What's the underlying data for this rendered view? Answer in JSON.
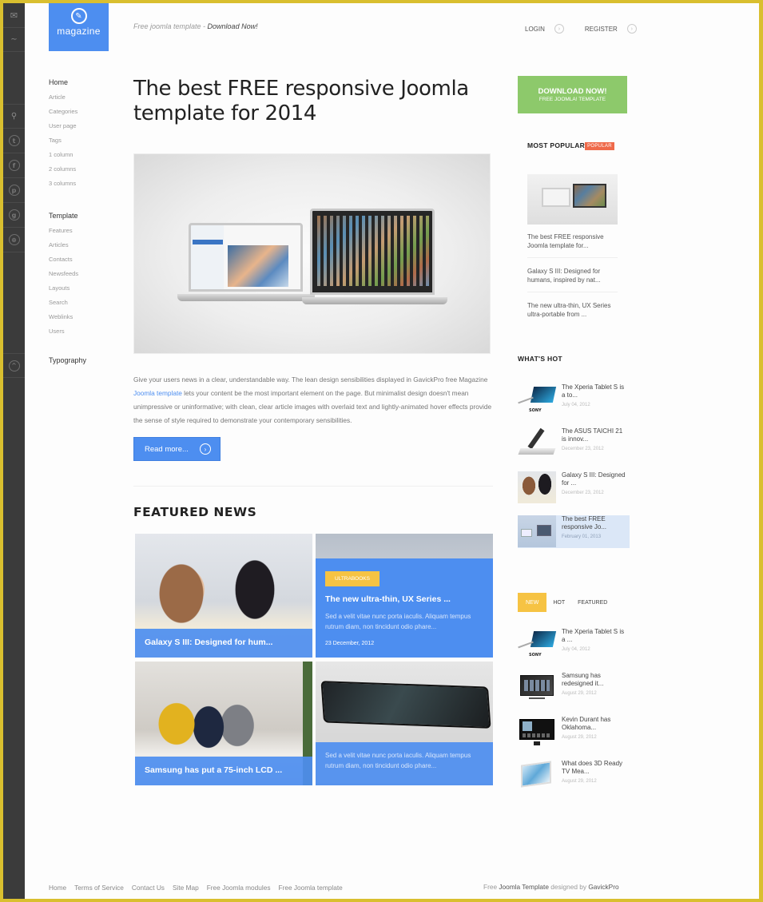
{
  "header": {
    "logo_text": "magazine",
    "tagline_prefix": "Free joomla template - ",
    "tagline_link": "Download Now!",
    "login": "LOGIN",
    "register": "REGISTER"
  },
  "side_bar_icons": [
    "mail-icon",
    "rss-icon",
    "search-icon",
    "twitter-icon",
    "facebook-icon",
    "pinterest-icon",
    "google-plus-icon",
    "globe-icon",
    "scroll-top-icon"
  ],
  "left_nav": {
    "groups": [
      {
        "title": "Home",
        "items": [
          "Article",
          "Categories",
          "User page",
          "Tags",
          "1 column",
          "2 columns",
          "3 columns"
        ]
      },
      {
        "title": "Template",
        "items": [
          "Features",
          "Articles",
          "Contacts",
          "Newsfeeds",
          "Layouts",
          "Search",
          "Weblinks",
          "Users"
        ]
      },
      {
        "title": "Typography",
        "items": []
      }
    ]
  },
  "main": {
    "title": "The best FREE responsive Joomla template for 2014",
    "text_before_link": "Give your users news in a clear, understandable way. The lean design sensibilities displayed in GavickPro free Magazine ",
    "text_link": "Joomla template",
    "text_after_link": " lets your content be the most important element on the page. But minimalist design doesn't mean unimpressive or uninformative; with clean, clear article images with overlaid text and lightly-animated hover effects provide the sense of style required to demonstrate your contemporary sensibilities.",
    "read_more": "Read more..."
  },
  "featured": {
    "title": "FEATURED NEWS",
    "tiles": [
      {
        "title": "Galaxy S III: Designed for hum..."
      },
      {
        "badge": "ULTRABOOKS",
        "title": "The new ultra-thin, UX Series ...",
        "desc": "Sed a velit vitae nunc porta iaculis. Aliquam tempus rutrum diam, non tincidunt odio phare...",
        "date": "23 December, 2012"
      },
      {
        "title": "Samsung has put a 75-inch LCD ..."
      },
      {
        "desc": "Sed a velit vitae nunc porta iaculis. Aliquam tempus rutrum diam, non tincidunt odio phare..."
      }
    ]
  },
  "right": {
    "download": {
      "line1": "DOWNLOAD NOW!",
      "line2": "FREE JOOMLA! TEMPLATE"
    },
    "most_popular": {
      "title": "MOST POPULAR",
      "badge": "POPULAR",
      "links": [
        "The best FREE responsive Joomla template for...",
        "Galaxy S III: Designed for humans, inspired by nat...",
        "The new ultra-thin, UX Series ultra-portable from ..."
      ]
    },
    "whats_hot": {
      "title": "WHAT'S HOT",
      "items": [
        {
          "title": "The Xperia Tablet S is a to...",
          "date": "July 04, 2012"
        },
        {
          "title": "The ASUS TAICHI 21 is innov...",
          "date": "December 23, 2012"
        },
        {
          "title": "Galaxy S III: Designed for ...",
          "date": "December 23, 2012"
        },
        {
          "title": "The best FREE responsive Jo...",
          "date": "February 01, 2013"
        }
      ]
    },
    "tabs": {
      "labels": [
        "NEW",
        "HOT",
        "FEATURED"
      ],
      "active": "NEW",
      "items": [
        {
          "title": "The Xperia Tablet S is a ...",
          "date": "July 04, 2012"
        },
        {
          "title": "Samsung has redesigned it...",
          "date": "August 29, 2012"
        },
        {
          "title": "Kevin Durant has Oklahoma...",
          "date": "August 29, 2012"
        },
        {
          "title": "What does 3D Ready TV Mea...",
          "date": "August 29, 2012"
        }
      ]
    }
  },
  "footer": {
    "links": [
      "Home",
      "Terms of Service",
      "Contact Us",
      "Site Map",
      "Free Joomla modules",
      "Free Joomla template"
    ],
    "credit_prefix": "Free ",
    "credit_link": "Joomla Template",
    "credit_mid": " designed by ",
    "credit_brand": "GavickPro"
  },
  "colors": {
    "accent_blue": "#4d8ef0",
    "download_green": "#8dc96b",
    "badge_yellow": "#f6c343",
    "popular_red": "#ef6a4a",
    "frame_border": "#d9bf2f"
  }
}
